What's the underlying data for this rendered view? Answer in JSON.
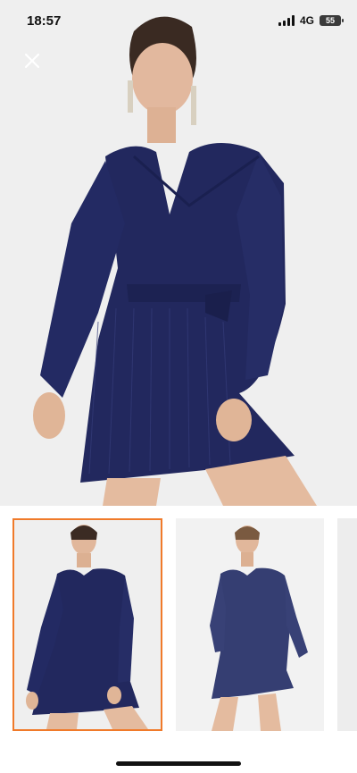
{
  "status_bar": {
    "time": "18:57",
    "network": "4G",
    "battery": "55"
  },
  "viewer": {
    "close_icon": "close-icon",
    "selected_thumbnail_color": "#f07a2a",
    "thumbnails": [
      {
        "label": "thumbnail-1",
        "selected": true
      },
      {
        "label": "thumbnail-2",
        "selected": false
      },
      {
        "label": "thumbnail-3",
        "selected": false
      }
    ]
  }
}
